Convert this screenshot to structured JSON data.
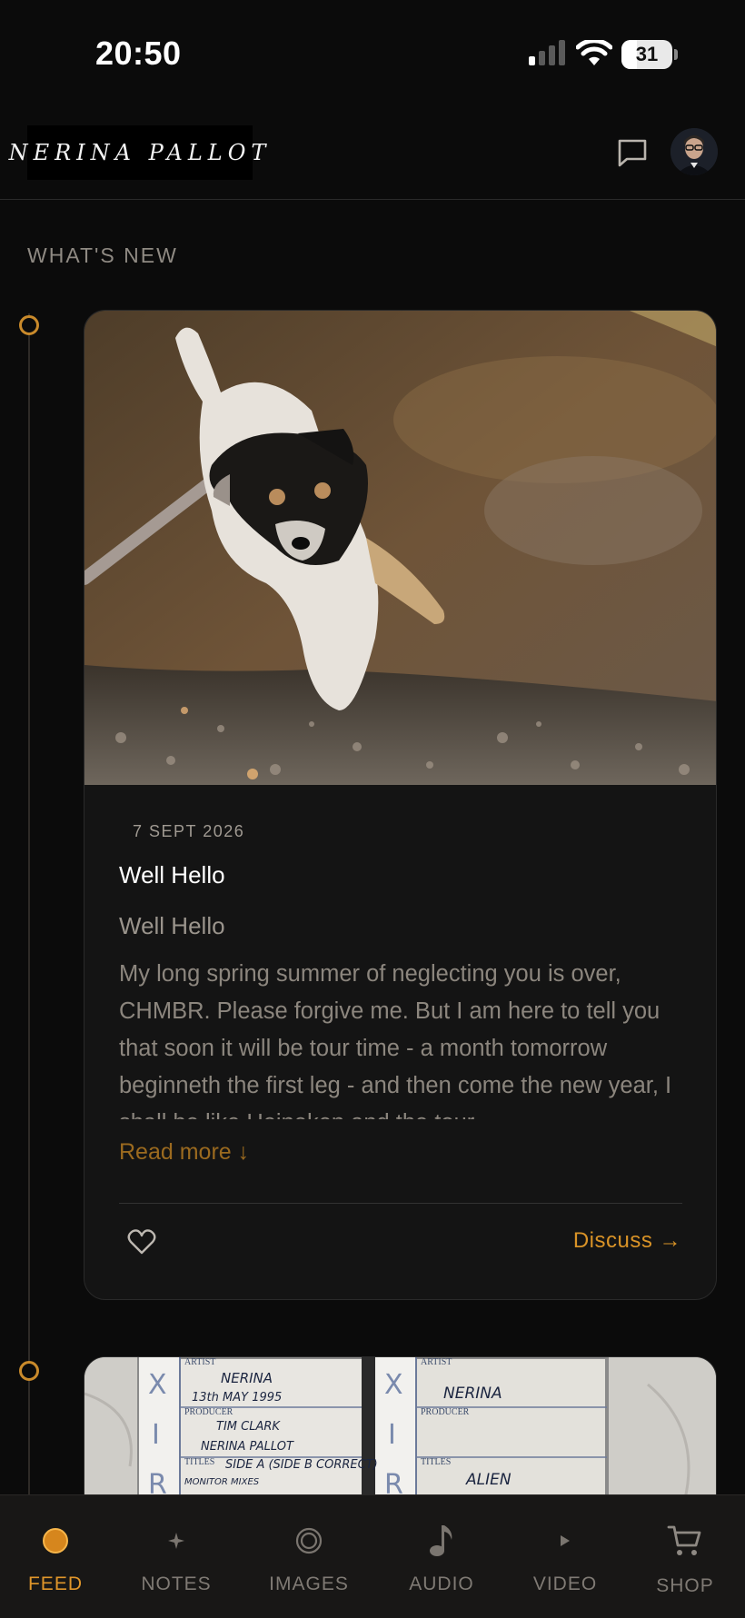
{
  "status_bar": {
    "time": "20:50",
    "battery": "31",
    "battery_level": 0.31
  },
  "header": {
    "logo_text": "NERINA PALLOT"
  },
  "feed": {
    "section_title": "WHAT'S NEW",
    "posts": [
      {
        "date": "7 SEPT 2026",
        "title": "Well Hello",
        "subtitle": "Well Hello",
        "body": "My long spring summer of neglecting you is over, CHMBR. Please forgive me. But I am here to tell you that soon it will be tour time - a month tomorrow beginneth the first leg - and then come the new year, I shall be like Heineken and the tour",
        "read_more": "Read more ↓",
        "discuss": "Discuss →"
      }
    ],
    "tape_labels": {
      "left": {
        "artist_label": "ARTIST",
        "artist": "NERINA",
        "date": "13th MAY 1995",
        "producer_label": "PRODUCER",
        "producer_1": "TIM CLARK",
        "producer_2": "NERINA PALLOT",
        "titles_label": "TITLES",
        "titles": "SIDE A (SIDE B CORRECT)",
        "titles_2": "MONITOR MIXES"
      },
      "right": {
        "artist_label": "ARTIST",
        "artist": "NERINA",
        "producer_label": "PRODUCER",
        "titles_label": "TITLES",
        "titles": "ALIEN"
      }
    }
  },
  "bottom_nav": {
    "items": [
      {
        "label": "FEED",
        "icon": "feed-dot-icon"
      },
      {
        "label": "NOTES",
        "icon": "sparkle-icon"
      },
      {
        "label": "IMAGES",
        "icon": "ring-icon"
      },
      {
        "label": "AUDIO",
        "icon": "music-note-icon"
      },
      {
        "label": "VIDEO",
        "icon": "play-icon"
      },
      {
        "label": "SHOP",
        "icon": "cart-icon"
      }
    ]
  },
  "colors": {
    "accent": "#e0962a",
    "background": "#0b0b0b",
    "card": "#141414"
  }
}
